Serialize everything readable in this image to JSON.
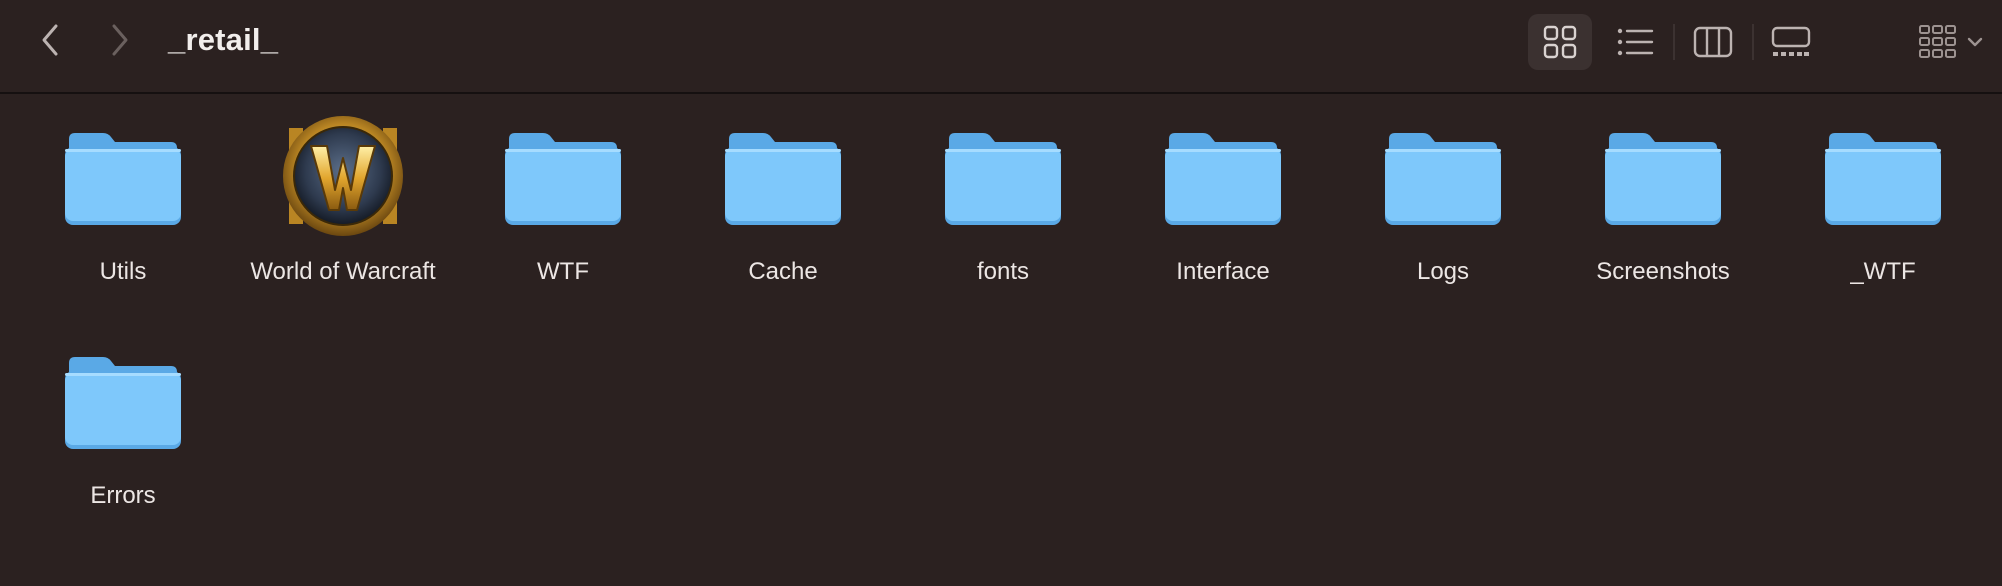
{
  "window": {
    "title": "_retail_"
  },
  "toolbar": {
    "back_icon": "chevron-left-icon",
    "forward_icon": "chevron-right-icon",
    "views": [
      {
        "name": "icon-view",
        "icon": "grid-icon",
        "selected": true
      },
      {
        "name": "list-view",
        "icon": "list-icon",
        "selected": false
      },
      {
        "name": "column-view",
        "icon": "columns-icon",
        "selected": false
      },
      {
        "name": "gallery-view",
        "icon": "gallery-icon",
        "selected": false
      },
      {
        "name": "group-view",
        "icon": "group-grid-icon",
        "selected": false
      }
    ]
  },
  "items": [
    {
      "label": "Utils",
      "type": "folder"
    },
    {
      "label": "World of Warcraft",
      "type": "app"
    },
    {
      "label": "WTF",
      "type": "folder"
    },
    {
      "label": "Cache",
      "type": "folder"
    },
    {
      "label": "fonts",
      "type": "folder"
    },
    {
      "label": "Interface",
      "type": "folder"
    },
    {
      "label": "Logs",
      "type": "folder"
    },
    {
      "label": "Screenshots",
      "type": "folder"
    },
    {
      "label": "_WTF",
      "type": "folder"
    },
    {
      "label": "Errors",
      "type": "folder"
    }
  ],
  "colors": {
    "background": "#2b2120",
    "folder_light": "#7ec8fb",
    "folder_dark": "#5aa9e6"
  }
}
